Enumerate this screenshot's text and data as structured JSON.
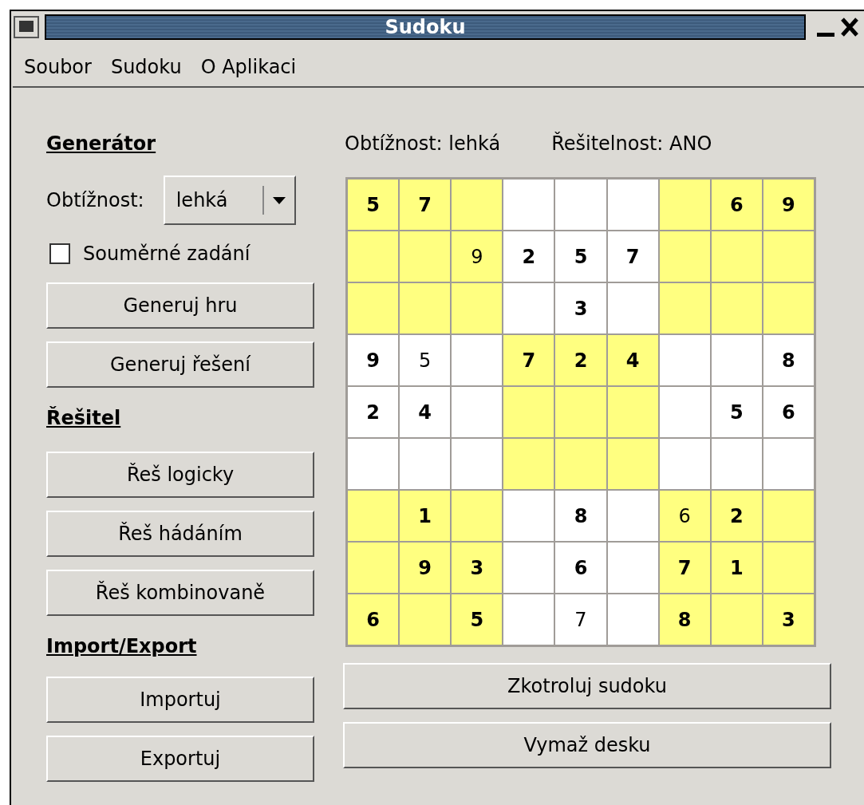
{
  "window": {
    "title": "Sudoku"
  },
  "menu": [
    "Soubor",
    "Sudoku",
    "O Aplikaci"
  ],
  "generator": {
    "heading": "Generátor",
    "difficulty_label": "Obtížnost:",
    "difficulty_value": "lehká",
    "symmetric": {
      "label": "Souměrné zadání",
      "checked": false
    },
    "buttons": [
      "Generuj hru",
      "Generuj řešení"
    ]
  },
  "solver": {
    "heading": "Řešitel",
    "buttons": [
      "Řeš logicky",
      "Řeš hádáním",
      "Řeš kombinovaně"
    ]
  },
  "import_export": {
    "heading": "Import/Export",
    "buttons": [
      "Importuj",
      "Exportuj"
    ]
  },
  "status": {
    "difficulty": "Obtížnost: lehká",
    "solvability": "Řešitelnost: ANO"
  },
  "board": [
    [
      {
        "kind": "given",
        "value": "5"
      },
      {
        "kind": "given",
        "value": "7"
      },
      {
        "kind": "empty"
      },
      {
        "kind": "empty"
      },
      {
        "kind": "empty"
      },
      {
        "kind": "empty"
      },
      {
        "kind": "empty"
      },
      {
        "kind": "given",
        "value": "6"
      },
      {
        "kind": "given",
        "value": "9"
      }
    ],
    [
      {
        "kind": "empty"
      },
      {
        "kind": "empty"
      },
      {
        "kind": "solved",
        "value": "9"
      },
      {
        "kind": "given",
        "value": "2"
      },
      {
        "kind": "given",
        "value": "5"
      },
      {
        "kind": "given",
        "value": "7"
      },
      {
        "kind": "empty"
      },
      {
        "kind": "empty"
      },
      {
        "kind": "empty"
      }
    ],
    [
      {
        "kind": "empty"
      },
      {
        "kind": "empty"
      },
      {
        "kind": "empty"
      },
      {
        "kind": "empty"
      },
      {
        "kind": "given",
        "value": "3"
      },
      {
        "kind": "empty"
      },
      {
        "kind": "empty"
      },
      {
        "kind": "empty"
      },
      {
        "kind": "empty"
      }
    ],
    [
      {
        "kind": "given",
        "value": "9"
      },
      {
        "kind": "solved",
        "value": "5"
      },
      {
        "kind": "empty"
      },
      {
        "kind": "given",
        "value": "7"
      },
      {
        "kind": "given",
        "value": "2"
      },
      {
        "kind": "given",
        "value": "4"
      },
      {
        "kind": "empty"
      },
      {
        "kind": "empty"
      },
      {
        "kind": "given",
        "value": "8"
      }
    ],
    [
      {
        "kind": "given",
        "value": "2"
      },
      {
        "kind": "given",
        "value": "4"
      },
      {
        "kind": "empty"
      },
      {
        "kind": "empty"
      },
      {
        "kind": "empty"
      },
      {
        "kind": "empty"
      },
      {
        "kind": "empty"
      },
      {
        "kind": "given",
        "value": "5"
      },
      {
        "kind": "given",
        "value": "6"
      }
    ],
    [
      {
        "kind": "empty"
      },
      {
        "kind": "empty"
      },
      {
        "kind": "empty"
      },
      {
        "kind": "empty"
      },
      {
        "kind": "empty"
      },
      {
        "kind": "empty"
      },
      {
        "kind": "empty"
      },
      {
        "kind": "empty"
      },
      {
        "kind": "empty"
      }
    ],
    [
      {
        "kind": "empty"
      },
      {
        "kind": "given",
        "value": "1"
      },
      {
        "kind": "empty"
      },
      {
        "kind": "empty"
      },
      {
        "kind": "given",
        "value": "8"
      },
      {
        "kind": "empty"
      },
      {
        "kind": "solved",
        "value": "6"
      },
      {
        "kind": "given",
        "value": "2"
      },
      {
        "kind": "empty"
      }
    ],
    [
      {
        "kind": "empty"
      },
      {
        "kind": "given",
        "value": "9"
      },
      {
        "kind": "given",
        "value": "3"
      },
      {
        "kind": "empty"
      },
      {
        "kind": "given",
        "value": "6"
      },
      {
        "kind": "empty"
      },
      {
        "kind": "given",
        "value": "7"
      },
      {
        "kind": "given",
        "value": "1"
      },
      {
        "kind": "empty"
      }
    ],
    [
      {
        "kind": "given",
        "value": "6"
      },
      {
        "kind": "empty"
      },
      {
        "kind": "given",
        "value": "5"
      },
      {
        "kind": "empty"
      },
      {
        "kind": "solved",
        "value": "7"
      },
      {
        "kind": "empty"
      },
      {
        "kind": "given",
        "value": "8"
      },
      {
        "kind": "empty"
      },
      {
        "kind": "given",
        "value": "3"
      }
    ]
  ],
  "board_buttons": [
    "Zkotroluj sudoku",
    "Vymaž desku"
  ]
}
